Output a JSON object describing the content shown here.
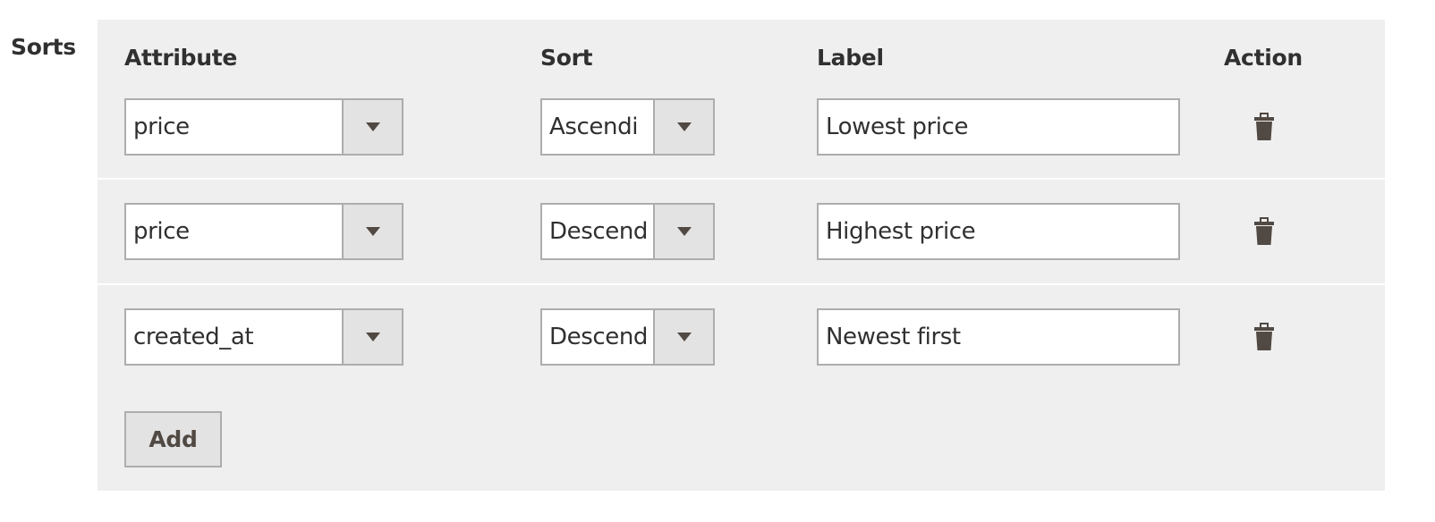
{
  "section": {
    "label": "Sorts"
  },
  "columns": {
    "attribute": "Attribute",
    "sort": "Sort",
    "label": "Label",
    "action": "Action"
  },
  "rows": [
    {
      "attribute": "price",
      "sort": "Ascendi",
      "label": "Lowest price",
      "action_icon": "trash-icon"
    },
    {
      "attribute": "price",
      "sort": "Descend",
      "label": "Highest price",
      "action_icon": "trash-icon"
    },
    {
      "attribute": "created_at",
      "sort": "Descend",
      "label": "Newest first",
      "action_icon": "trash-icon"
    }
  ],
  "add_button": {
    "label": "Add"
  },
  "colors": {
    "panel_bg": "#efefef",
    "border": "#adadad",
    "button_bg": "#e3e3e3",
    "icon": "#514943",
    "text": "#303030"
  }
}
